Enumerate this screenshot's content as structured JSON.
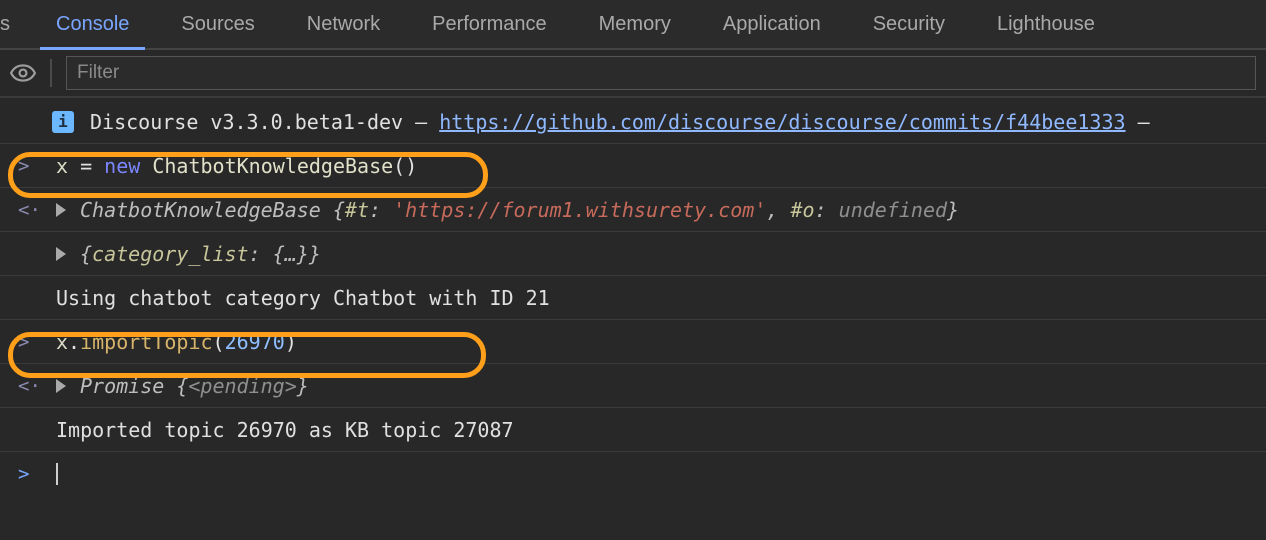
{
  "tabs": {
    "partial": "s",
    "console": "Console",
    "sources": "Sources",
    "network": "Network",
    "performance": "Performance",
    "memory": "Memory",
    "application": "Application",
    "security": "Security",
    "lighthouse": "Lighthouse"
  },
  "filter": {
    "placeholder": "Filter"
  },
  "syntax": {
    "new": "new",
    "undefined": "undefined",
    "pending": "<pending>"
  },
  "lines": {
    "info_prefix": "Discourse v3.3.0.beta1-dev — ",
    "info_link": "https://github.com/discourse/discourse/commits/f44bee1333",
    "info_tail": " —",
    "l1_var": "x",
    "l1_eq": " = ",
    "l1_cls": "ChatbotKnowledgeBase",
    "l1_parens": "()",
    "l2_cls": "ChatbotKnowledgeBase",
    "l2_open": " {",
    "l2_k1": "#t",
    "l2_sep1": ": ",
    "l2_v1": "'https://forum1.withsurety.com'",
    "l2_c1": ", ",
    "l2_k2": "#o",
    "l2_sep2": ": ",
    "l2_close": "}",
    "l3_open": "{",
    "l3_key": "category_list",
    "l3_sep": ": ",
    "l3_val": "{…}",
    "l3_close": "}",
    "l4_text": "Using chatbot category Chatbot with ID 21",
    "l5_var": "x",
    "l5_dot": ".",
    "l5_fn": "importTopic",
    "l5_open": "(",
    "l5_num": "26970",
    "l5_close": ")",
    "l6_cls": "Promise",
    "l6_open": " {",
    "l6_close": "}",
    "l7_text": "Imported topic 26970 as KB topic 27087"
  },
  "icons": {
    "prompt": ">",
    "result": "<·",
    "info": "i"
  }
}
